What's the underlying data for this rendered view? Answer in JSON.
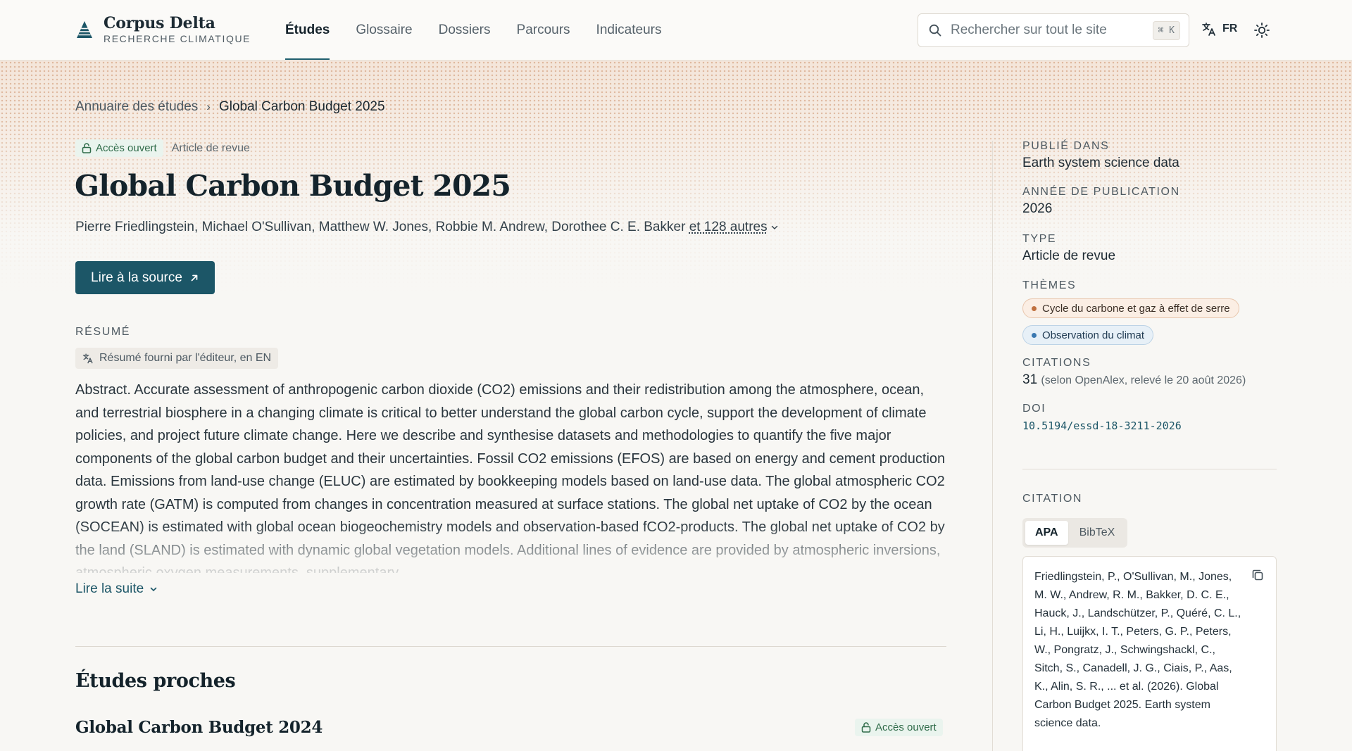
{
  "brand": {
    "name": "Corpus Delta",
    "subtitle": "RECHERCHE CLIMATIQUE"
  },
  "nav": {
    "items": [
      {
        "label": "Études",
        "active": true
      },
      {
        "label": "Glossaire",
        "active": false
      },
      {
        "label": "Dossiers",
        "active": false
      },
      {
        "label": "Parcours",
        "active": false
      },
      {
        "label": "Indicateurs",
        "active": false
      }
    ]
  },
  "search": {
    "placeholder": "Rechercher sur tout le site",
    "shortcut": "⌘ K"
  },
  "language": {
    "code": "FR"
  },
  "breadcrumb": {
    "parent": "Annuaire des études",
    "current": "Global Carbon Budget 2025"
  },
  "article": {
    "access_badge": "Accès ouvert",
    "type_badge": "Article de revue",
    "title": "Global Carbon Budget 2025",
    "authors": "Pierre Friedlingstein, Michael O'Sullivan, Matthew W. Jones, Robbie M. Andrew, Dorothee C. E. Bakker",
    "authors_more": "et 128 autres",
    "source_button": "Lire à la source"
  },
  "summary": {
    "label": "RÉSUMÉ",
    "provider_note": "Résumé fourni par l'éditeur, en EN",
    "text": "Abstract. Accurate assessment of anthropogenic carbon dioxide (CO2) emissions and their redistribution among the atmosphere, ocean, and terrestrial biosphere in a changing climate is critical to better understand the global carbon cycle, support the development of climate policies, and project future climate change. Here we describe and synthesise datasets and methodologies to quantify the five major components of the global carbon budget and their uncertainties. Fossil CO2 emissions (EFOS) are based on energy and cement production data. Emissions from land-use change (ELUC) are estimated by bookkeeping models based on land-use data. The global atmospheric CO2 growth rate (GATM) is computed from changes in concentration measured at surface stations. The global net uptake of CO2 by the ocean (SOCEAN) is estimated with global ocean biogeochemistry models and observation-based fCO2-products. The global net uptake of CO2 by the land (SLAND) is estimated with dynamic global vegetation models. Additional lines of evidence are provided by atmospheric inversions, atmospheric oxygen measurements, supplementary",
    "read_more": "Lire la suite"
  },
  "related": {
    "heading": "Études proches",
    "items": [
      {
        "title": "Global Carbon Budget 2024",
        "badge": "Accès ouvert"
      }
    ]
  },
  "sidebar": {
    "published_in_label": "PUBLIÉ DANS",
    "published_in": "Earth system science data",
    "year_label": "ANNÉE DE PUBLICATION",
    "year": "2026",
    "type_label": "TYPE",
    "type": "Article de revue",
    "themes_label": "THÈMES",
    "themes": [
      {
        "label": "Cycle du carbone et gaz à effet de serre",
        "color": "#c0703f"
      },
      {
        "label": "Observation du climat",
        "color": "#3a78b0"
      }
    ],
    "citations_label": "CITATIONS",
    "citations_count": "31",
    "citations_note": "(selon OpenAlex, relevé le 20 août 2026)",
    "doi_label": "DOI",
    "doi": "10.5194/essd-18-3211-2026",
    "citation_label": "CITATION",
    "citation_tabs": [
      {
        "label": "APA",
        "active": true
      },
      {
        "label": "BibTeX",
        "active": false
      }
    ],
    "citation_text": "Friedlingstein, P., O'Sullivan, M., Jones, M. W., Andrew, R. M., Bakker, D. C. E., Hauck, J., Landschützer, P., Quéré, C. L., Li, H., Luijkx, I. T., Peters, G. P., Peters, W., Pongratz, J., Schwingshackl, C., Sitch, S., Canadell, J. G., Ciais, P., Aas, K., Alin, S. R., ... et al. (2026). Global Carbon Budget 2025. Earth system science data."
  },
  "colors": {
    "accent": "#1c5667",
    "open_access_bg": "#eaf4ee",
    "open_access_text": "#2f6b49",
    "hero_pattern": "#ce946e"
  },
  "icons": {
    "brand": "triangle-stack-icon",
    "search": "search-icon",
    "language": "translate-icon",
    "theme": "sun-icon",
    "lock": "lock-open-icon",
    "external": "arrow-up-right-icon",
    "chevron": "chevron-down-icon",
    "copy": "copy-icon"
  }
}
